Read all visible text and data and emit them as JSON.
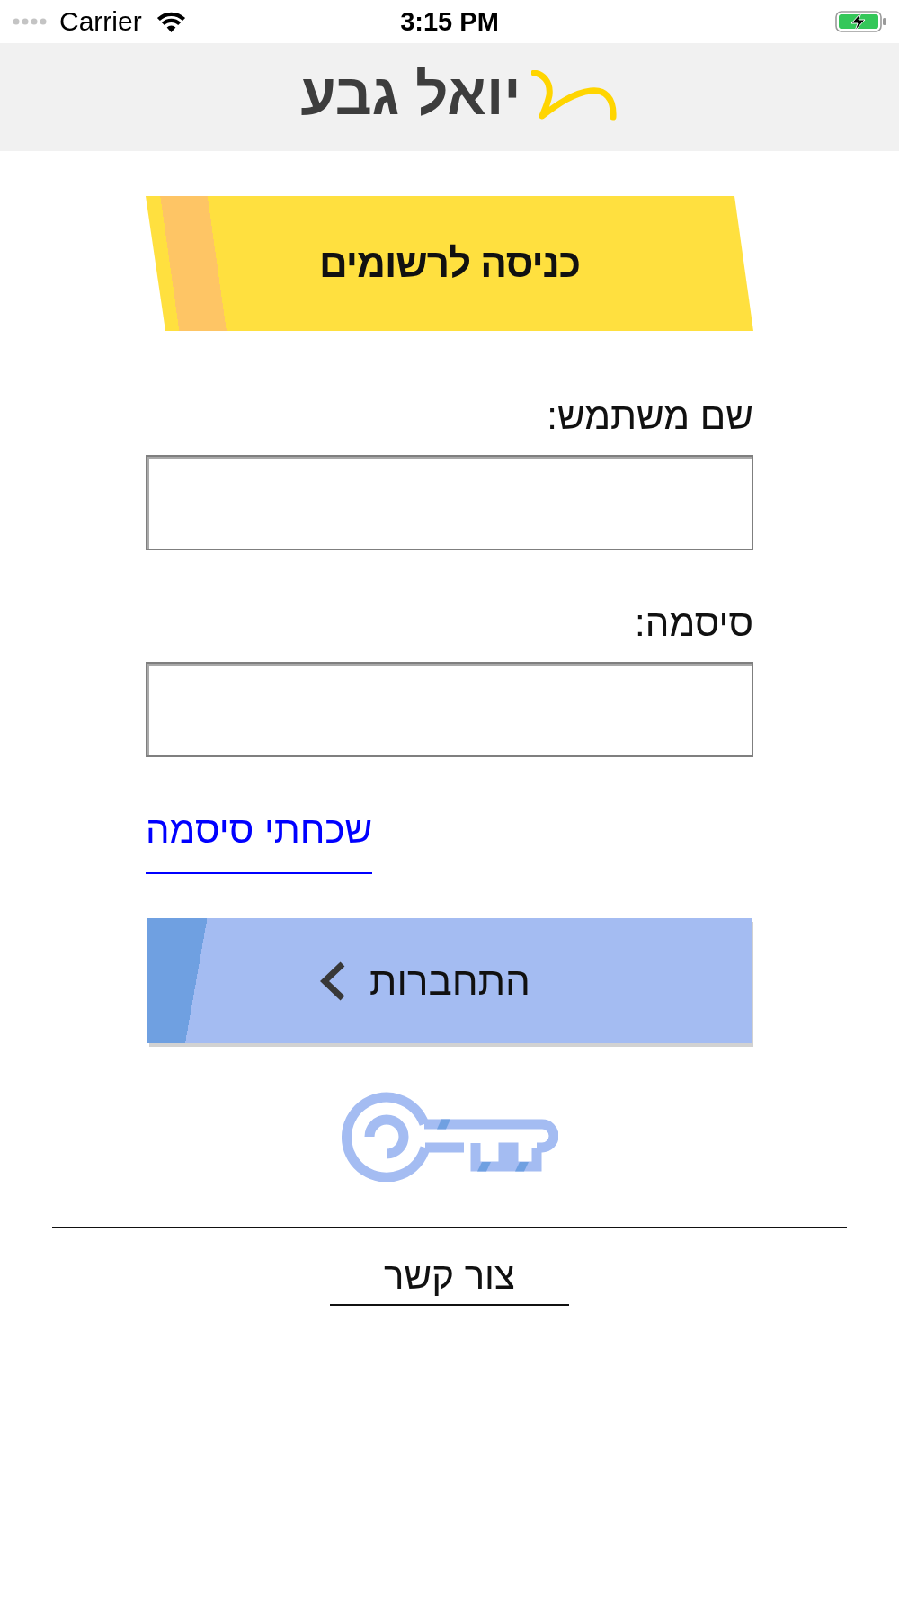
{
  "status_bar": {
    "carrier": "Carrier",
    "time": "3:15 PM"
  },
  "header": {
    "logo_text": "יואל גבע"
  },
  "banner": {
    "title": "כניסה לרשומים"
  },
  "form": {
    "fields": [
      {
        "label": "שם משתמש:"
      },
      {
        "label": "סיסמה:"
      }
    ],
    "forgot_link": "שכחתי סיסמה",
    "login_button": "התחברות"
  },
  "footer": {
    "contact_link": "צור קשר"
  }
}
